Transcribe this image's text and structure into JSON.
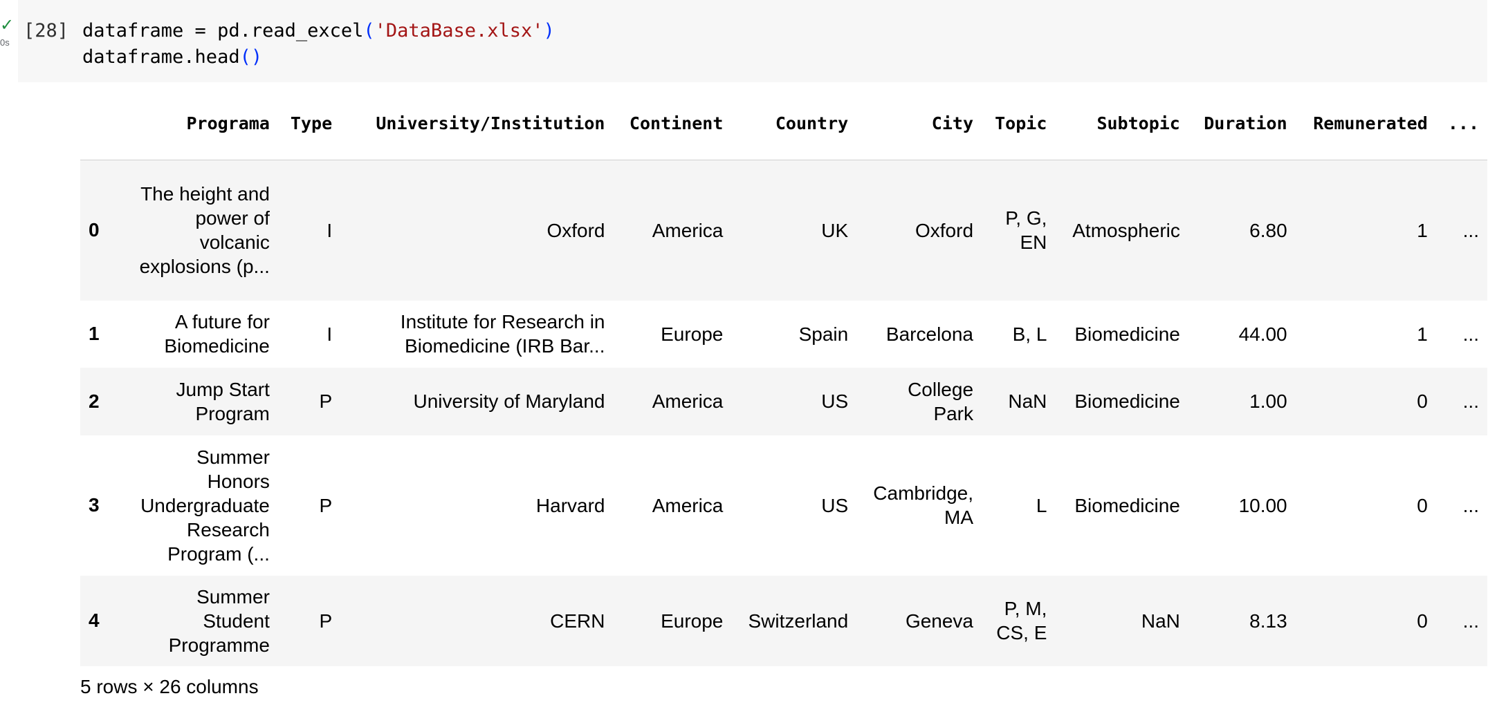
{
  "cell": {
    "status_icon": "check-icon",
    "status_color": "#1e8e3e",
    "exec_time": "0s",
    "execution_count": "[28]",
    "code_line1": {
      "pre": "dataframe = pd.read_excel",
      "open": "(",
      "str": "'DataBase.xlsx'",
      "close": ")"
    },
    "code_line2": {
      "pre": "dataframe.head",
      "parens": "()"
    }
  },
  "table": {
    "index_header": "",
    "columns": [
      "Programa",
      "Type",
      "University/Institution",
      "Continent",
      "Country",
      "City",
      "Topic",
      "Subtopic",
      "Duration",
      "Remunerated",
      "..."
    ],
    "rows": [
      {
        "index": "0",
        "cells": [
          "The height and power of volcanic explosions (p...",
          "I",
          "Oxford",
          "America",
          "UK",
          "Oxford",
          "P, G, EN",
          "Atmospheric",
          "6.80",
          "1",
          "..."
        ]
      },
      {
        "index": "1",
        "cells": [
          "A future for Biomedicine",
          "I",
          "Institute for Research in Biomedicine (IRB Bar...",
          "Europe",
          "Spain",
          "Barcelona",
          "B, L",
          "Biomedicine",
          "44.00",
          "1",
          "..."
        ]
      },
      {
        "index": "2",
        "cells": [
          "Jump Start Program",
          "P",
          "University of Maryland",
          "America",
          "US",
          "College Park",
          "NaN",
          "Biomedicine",
          "1.00",
          "0",
          "..."
        ]
      },
      {
        "index": "3",
        "cells": [
          "Summer Honors Undergraduate Research Program (...",
          "P",
          "Harvard",
          "America",
          "US",
          "Cambridge, MA",
          "L",
          "Biomedicine",
          "10.00",
          "0",
          "..."
        ]
      },
      {
        "index": "4",
        "cells": [
          "Summer Student Programme",
          "P",
          "CERN",
          "Europe",
          "Switzerland",
          "Geneva",
          "P, M, CS, E",
          "NaN",
          "8.13",
          "0",
          "..."
        ]
      }
    ]
  },
  "shape_summary": "5 rows × 26 columns"
}
